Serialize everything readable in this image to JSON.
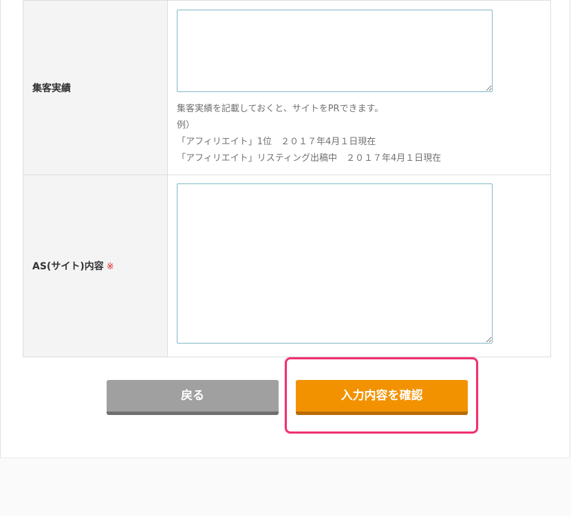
{
  "form": {
    "rows": [
      {
        "label": "集客実績",
        "required": false,
        "value": "",
        "help": [
          "集客実績を記載しておくと、サイトをPRできます。",
          "例）",
          "「アフィリエイト」1位　２０１７年4月１日現在",
          "「アフィリエイト」リスティング出稿中　２０１７年4月１日現在"
        ]
      },
      {
        "label": "AS(サイト)内容",
        "required": true,
        "required_mark": "※",
        "value": ""
      }
    ]
  },
  "buttons": {
    "back_label": "戻る",
    "confirm_label": "入力内容を確認"
  },
  "colors": {
    "confirm_button": "#f39200",
    "back_button": "#a0a0a0",
    "highlight_border": "#f0306e",
    "required_mark": "#e02525"
  }
}
